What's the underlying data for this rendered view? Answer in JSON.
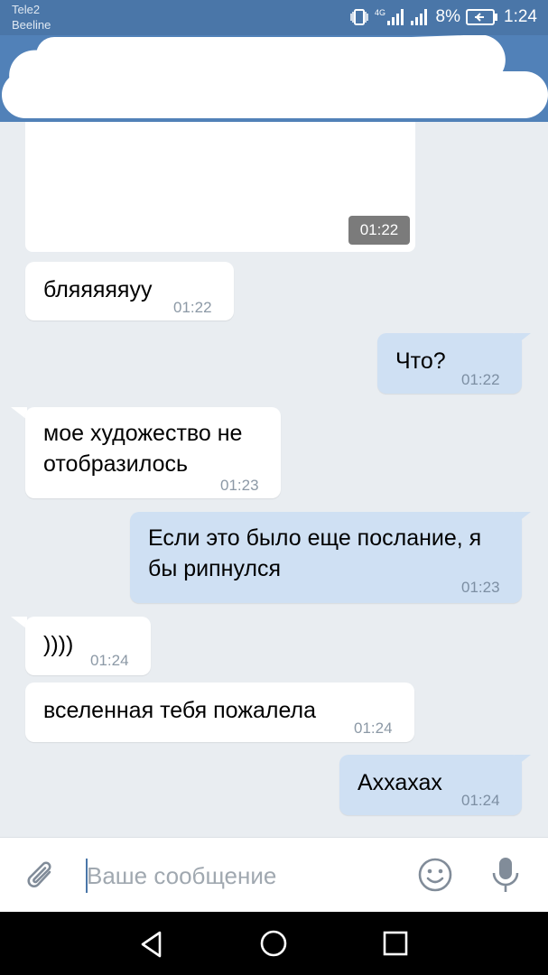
{
  "status_bar": {
    "carrier1": "Tele2",
    "carrier2": "Beeline",
    "battery": "8%",
    "time": "1:24",
    "network": "4G"
  },
  "messages": [
    {
      "dir": "in",
      "text": "бляяяяяуу",
      "time": "01:22"
    },
    {
      "dir": "out",
      "text": "Что?",
      "time": "01:22"
    },
    {
      "dir": "in",
      "text1": "мое художество не",
      "text2": "отобразилось",
      "time": "01:23"
    },
    {
      "dir": "out",
      "text1": "Если это было еще послание, я",
      "text2": "бы рипнулся",
      "time": "01:23"
    },
    {
      "dir": "in",
      "text": "))))",
      "time": "01:24"
    },
    {
      "dir": "in",
      "text": "вселенная тебя пожалела",
      "time": "01:24"
    },
    {
      "dir": "out",
      "text": "Аххахах",
      "time": "01:24"
    }
  ],
  "photo": {
    "time": "01:22"
  },
  "compose": {
    "placeholder": "Ваше сообщение"
  },
  "colors": {
    "header": "#5181b8",
    "status_bar": "#4a76a8",
    "outgoing": "#cfe0f3",
    "incoming": "#ffffff",
    "background": "#e9edf1"
  },
  "icons": [
    "attach-icon",
    "emoji-icon",
    "microphone-icon",
    "back-icon",
    "home-icon",
    "recents-icon",
    "vibrate-icon",
    "signal-icon",
    "battery-icon"
  ]
}
